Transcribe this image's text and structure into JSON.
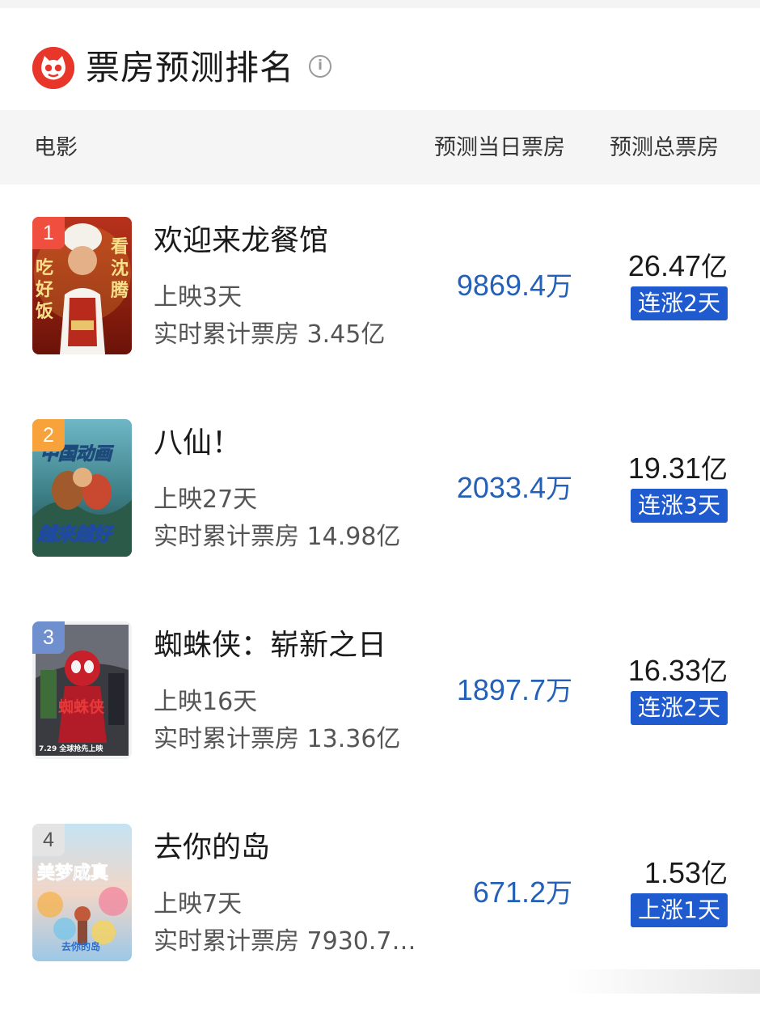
{
  "header": {
    "title": "票房预测排名",
    "info_icon": "info-icon",
    "logo_icon": "cat-logo-icon"
  },
  "columns": {
    "movie": "电影",
    "daily": "预测当日票房",
    "total": "预测总票房"
  },
  "colors": {
    "brand_red": "#e8372a",
    "daily_value_blue": "#2460b8",
    "trend_badge_blue": "#1f5bcf",
    "rank1": "#f04e3e",
    "rank2": "#f7a23a",
    "rank3": "#6f8fce",
    "rank4": "#e4e4e4"
  },
  "movies": [
    {
      "rank": "1",
      "title": "欢迎来龙餐馆",
      "release": "上映3天",
      "cumulative": "实时累计票房 3.45亿",
      "daily_value": "9869.4",
      "daily_unit": "万",
      "total_value": "26.47",
      "total_unit": "亿",
      "trend": "连涨2天"
    },
    {
      "rank": "2",
      "title": "八仙！",
      "release": "上映27天",
      "cumulative": "实时累计票房 14.98亿",
      "daily_value": "2033.4",
      "daily_unit": "万",
      "total_value": "19.31",
      "total_unit": "亿",
      "trend": "连涨3天"
    },
    {
      "rank": "3",
      "title": "蜘蛛侠：崭新之日",
      "release": "上映16天",
      "cumulative": "实时累计票房 13.36亿",
      "daily_value": "1897.7",
      "daily_unit": "万",
      "total_value": "16.33",
      "total_unit": "亿",
      "trend": "连涨2天"
    },
    {
      "rank": "4",
      "title": "去你的岛",
      "release": "上映7天",
      "cumulative": "实时累计票房 7930.7…",
      "daily_value": "671.2",
      "daily_unit": "万",
      "total_value": "1.53",
      "total_unit": "亿",
      "trend": "上涨1天"
    }
  ],
  "posters": [
    {
      "lines_left": [
        "吃",
        "好",
        "饭"
      ],
      "lines_right": [
        "看",
        "沈",
        "腾"
      ]
    },
    {
      "line1": "中国动画",
      "line2": "越来越好"
    },
    {
      "line1": "蜘蛛侠",
      "line2": "7.29 全球抢先上映"
    },
    {
      "line1": "美梦成真",
      "line2": "去你的岛"
    }
  ]
}
